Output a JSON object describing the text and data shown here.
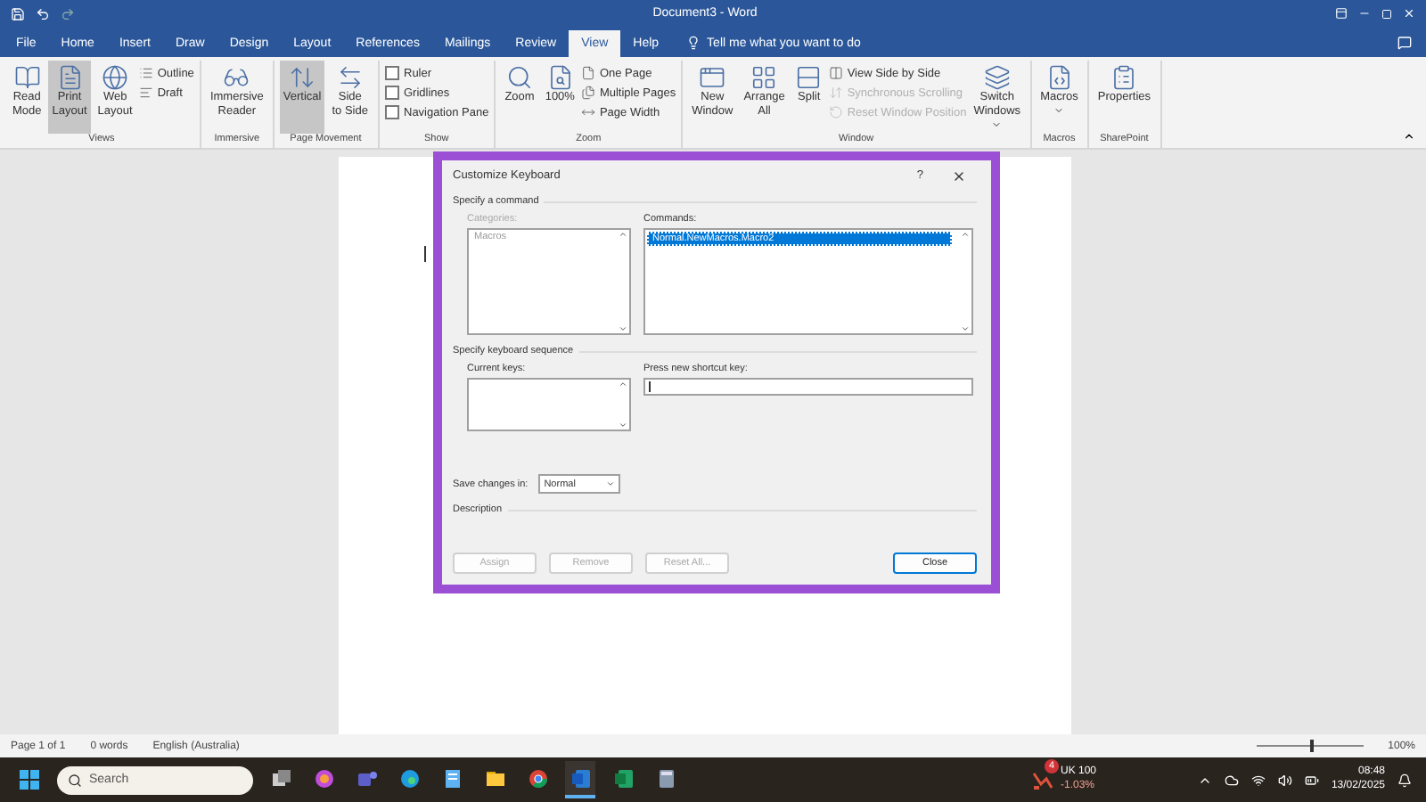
{
  "window": {
    "title": "Document3 - Word"
  },
  "tabs": [
    {
      "label": "File",
      "selected": false
    },
    {
      "label": "Home",
      "selected": false
    },
    {
      "label": "Insert",
      "selected": false
    },
    {
      "label": "Draw",
      "selected": false
    },
    {
      "label": "Design",
      "selected": false
    },
    {
      "label": "Layout",
      "selected": false
    },
    {
      "label": "References",
      "selected": false
    },
    {
      "label": "Mailings",
      "selected": false
    },
    {
      "label": "Review",
      "selected": false
    },
    {
      "label": "View",
      "selected": true
    },
    {
      "label": "Help",
      "selected": false
    }
  ],
  "tell_me": "Tell me what you want to do",
  "ribbon": {
    "groups": [
      {
        "label": "Views",
        "items": [
          {
            "kind": "large",
            "label": "Read\nMode",
            "selected": false
          },
          {
            "kind": "large",
            "label": "Print\nLayout",
            "selected": true
          },
          {
            "kind": "large",
            "label": "Web\nLayout",
            "selected": false
          },
          {
            "kind": "small",
            "label": "Outline",
            "disabled": false
          },
          {
            "kind": "small",
            "label": "Draft",
            "disabled": false
          }
        ]
      },
      {
        "label": "Immersive",
        "items": [
          {
            "kind": "large",
            "label": "Immersive\nReader",
            "selected": false
          }
        ]
      },
      {
        "label": "Page Movement",
        "items": [
          {
            "kind": "large",
            "label": "Vertical",
            "selected": true
          },
          {
            "kind": "large",
            "label": "Side\nto Side",
            "selected": false
          }
        ]
      },
      {
        "label": "Show",
        "items": [
          {
            "kind": "check",
            "label": "Ruler",
            "checked": false
          },
          {
            "kind": "check",
            "label": "Gridlines",
            "checked": false
          },
          {
            "kind": "check",
            "label": "Navigation Pane",
            "checked": false
          }
        ]
      },
      {
        "label": "Zoom",
        "items": [
          {
            "kind": "large",
            "label": "Zoom",
            "selected": false
          },
          {
            "kind": "large",
            "label": "100%",
            "selected": false
          },
          {
            "kind": "small",
            "label": "One Page",
            "disabled": false
          },
          {
            "kind": "small",
            "label": "Multiple Pages",
            "disabled": false
          },
          {
            "kind": "small",
            "label": "Page Width",
            "disabled": false
          }
        ]
      },
      {
        "label": "Window",
        "items": [
          {
            "kind": "large",
            "label": "New\nWindow",
            "selected": false
          },
          {
            "kind": "large",
            "label": "Arrange\nAll",
            "selected": false
          },
          {
            "kind": "large",
            "label": "Split",
            "selected": false
          },
          {
            "kind": "small",
            "label": "View Side by Side",
            "disabled": false
          },
          {
            "kind": "small",
            "label": "Synchronous Scrolling",
            "disabled": true
          },
          {
            "kind": "small",
            "label": "Reset Window Position",
            "disabled": true
          },
          {
            "kind": "large",
            "label": "Switch\nWindows",
            "selected": false,
            "dropdown": true
          }
        ]
      },
      {
        "label": "Macros",
        "items": [
          {
            "kind": "large",
            "label": "Macros",
            "selected": false,
            "dropdown": true
          }
        ]
      },
      {
        "label": "SharePoint",
        "items": [
          {
            "kind": "large",
            "label": "Properties",
            "selected": false
          }
        ]
      }
    ]
  },
  "dialog": {
    "title": "Customize Keyboard",
    "help": "?",
    "command_section": "Specify a command",
    "categories": {
      "label": "Categories:",
      "items": [
        "Macros"
      ]
    },
    "commands": {
      "label": "Commands:",
      "items": [
        {
          "label": "Normal.NewMacros.Macro2",
          "selected": true
        }
      ]
    },
    "sequence_section": "Specify keyboard sequence",
    "current_keys": {
      "label": "Current keys:"
    },
    "new_key": {
      "label": "Press new shortcut key:"
    },
    "save_in": {
      "label": "Save changes in:",
      "value": "Normal"
    },
    "description": {
      "label": "Description"
    },
    "buttons": [
      {
        "label": "Assign",
        "disabled": true,
        "default": false
      },
      {
        "label": "Remove",
        "disabled": true,
        "default": false
      },
      {
        "label": "Reset All...",
        "disabled": true,
        "default": false
      },
      {
        "label": "Close",
        "disabled": false,
        "default": true
      }
    ]
  },
  "status_bar": {
    "items": [
      "Page 1 of 1",
      "0 words",
      "English (Australia)"
    ],
    "zoom": "100%",
    "zoom_slider": {
      "level": 0.5
    }
  },
  "taskbar": {
    "search_placeholder": "Search",
    "apps": [
      {
        "kind": "taskview",
        "active": false
      },
      {
        "kind": "copilot",
        "active": false
      },
      {
        "kind": "teams",
        "active": false
      },
      {
        "kind": "edge",
        "active": false
      },
      {
        "kind": "notepad",
        "active": false
      },
      {
        "kind": "folder",
        "active": false
      },
      {
        "kind": "chrome",
        "active": false
      },
      {
        "kind": "word",
        "active": true
      },
      {
        "kind": "excel",
        "active": false
      },
      {
        "kind": "calculator",
        "active": false
      }
    ],
    "stock": {
      "badge": "4",
      "name": "UK 100",
      "change": "-1.03%"
    },
    "time": "08:48",
    "date": "13/02/2025"
  }
}
